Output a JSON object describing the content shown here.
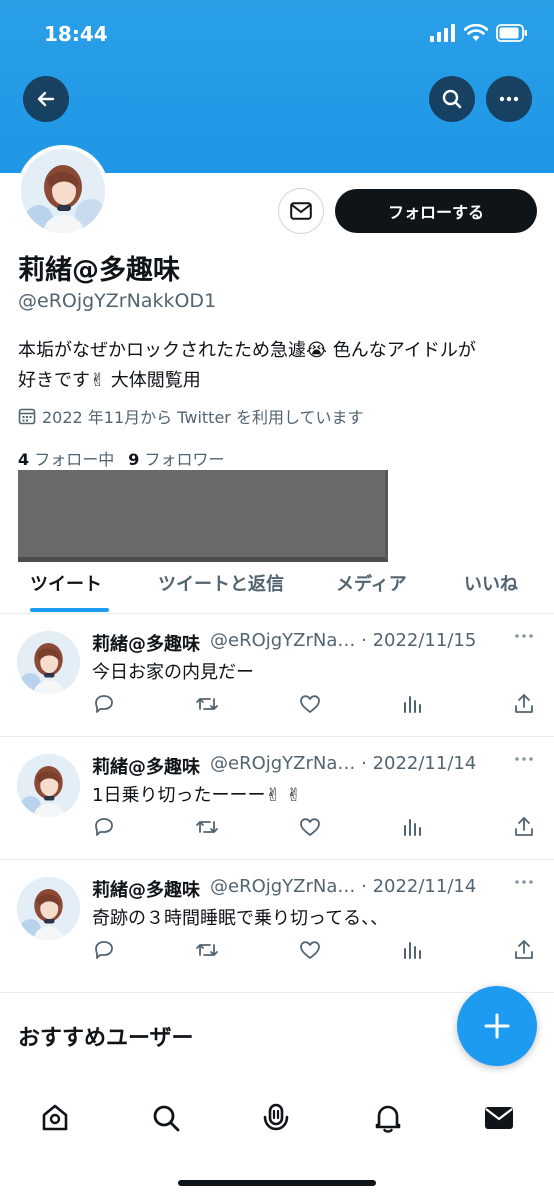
{
  "status": {
    "time": "18:44"
  },
  "profile": {
    "display_name": "莉緒@多趣味",
    "handle": "@eROjgYZrNakkOD1",
    "bio_line1": "本垢がなぜかロックされたため急遽😭 色んなアイドルが",
    "bio_line2": "好きです✌ 大体閲覧用",
    "joined": "2022 年11月から Twitter を利用しています",
    "following_count": "4",
    "following_label": "フォロー中",
    "followers_count": "9",
    "followers_label": "フォロワー",
    "follow_button": "フォローする"
  },
  "tabs": [
    "ツイート",
    "ツイートと返信",
    "メディア",
    "いいね"
  ],
  "tweets": [
    {
      "name": "莉緒@多趣味",
      "meta": "@eROjgYZrNa… · 2022/11/15",
      "text": "今日お家の内見だー"
    },
    {
      "name": "莉緒@多趣味",
      "meta": "@eROjgYZrNa… · 2022/11/14",
      "text": "1日乗り切ったーーー✌ ✌"
    },
    {
      "name": "莉緒@多趣味",
      "meta": "@eROjgYZrNa… · 2022/11/14",
      "text": "奇跡の３時間睡眠で乗り切ってる、、"
    }
  ],
  "suggest_title": "おすすめユーザー",
  "colors": {
    "banner": "#1f97e6",
    "accent": "#1d9bf0",
    "text": "#0f1419",
    "muted": "#536471"
  },
  "icons": [
    "back-arrow-icon",
    "search-icon",
    "more-icon",
    "mail-icon",
    "calendar-icon",
    "reply-icon",
    "retweet-icon",
    "like-icon",
    "analytics-icon",
    "share-icon",
    "compose-icon",
    "home-icon",
    "spaces-icon",
    "bell-icon",
    "messages-icon"
  ]
}
